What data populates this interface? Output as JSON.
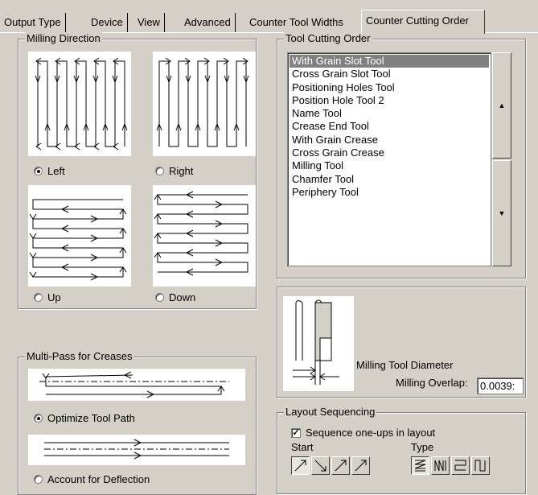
{
  "tabs": [
    {
      "label": "Output Type"
    },
    {
      "label": "Device"
    },
    {
      "label": "View"
    },
    {
      "label": "Advanced"
    },
    {
      "label": "Counter Tool Widths"
    },
    {
      "label": "Counter Cutting Order"
    }
  ],
  "milling_direction": {
    "title": "Milling Direction",
    "options": {
      "left": "Left",
      "right": "Right",
      "up": "Up",
      "down": "Down"
    },
    "selected": "Left"
  },
  "multi_pass": {
    "title": "Multi-Pass for Creases",
    "options": {
      "optimize": "Optimize Tool Path",
      "deflection": "Account for Deflection"
    },
    "selected": "Optimize Tool Path"
  },
  "tool_cutting_order": {
    "title": "Tool Cutting Order",
    "items": [
      "With Grain Slot Tool",
      "Cross Grain Slot Tool",
      "Positioning Holes Tool",
      "Position Hole Tool 2",
      "Name Tool",
      "Crease End Tool",
      "With Grain Crease",
      "Cross Grain Crease",
      "Milling Tool",
      "Chamfer Tool",
      "Periphery Tool"
    ],
    "selected": "With Grain Slot Tool"
  },
  "milling_tool": {
    "diameter_label": "Milling Tool Diameter",
    "overlap_label": "Milling Overlap:",
    "overlap_value": "0.0039:"
  },
  "layout_sequencing": {
    "title": "Layout Sequencing",
    "checkbox_label": "Sequence one-ups in layout",
    "checked": true,
    "start_label": "Start",
    "type_label": "Type"
  }
}
